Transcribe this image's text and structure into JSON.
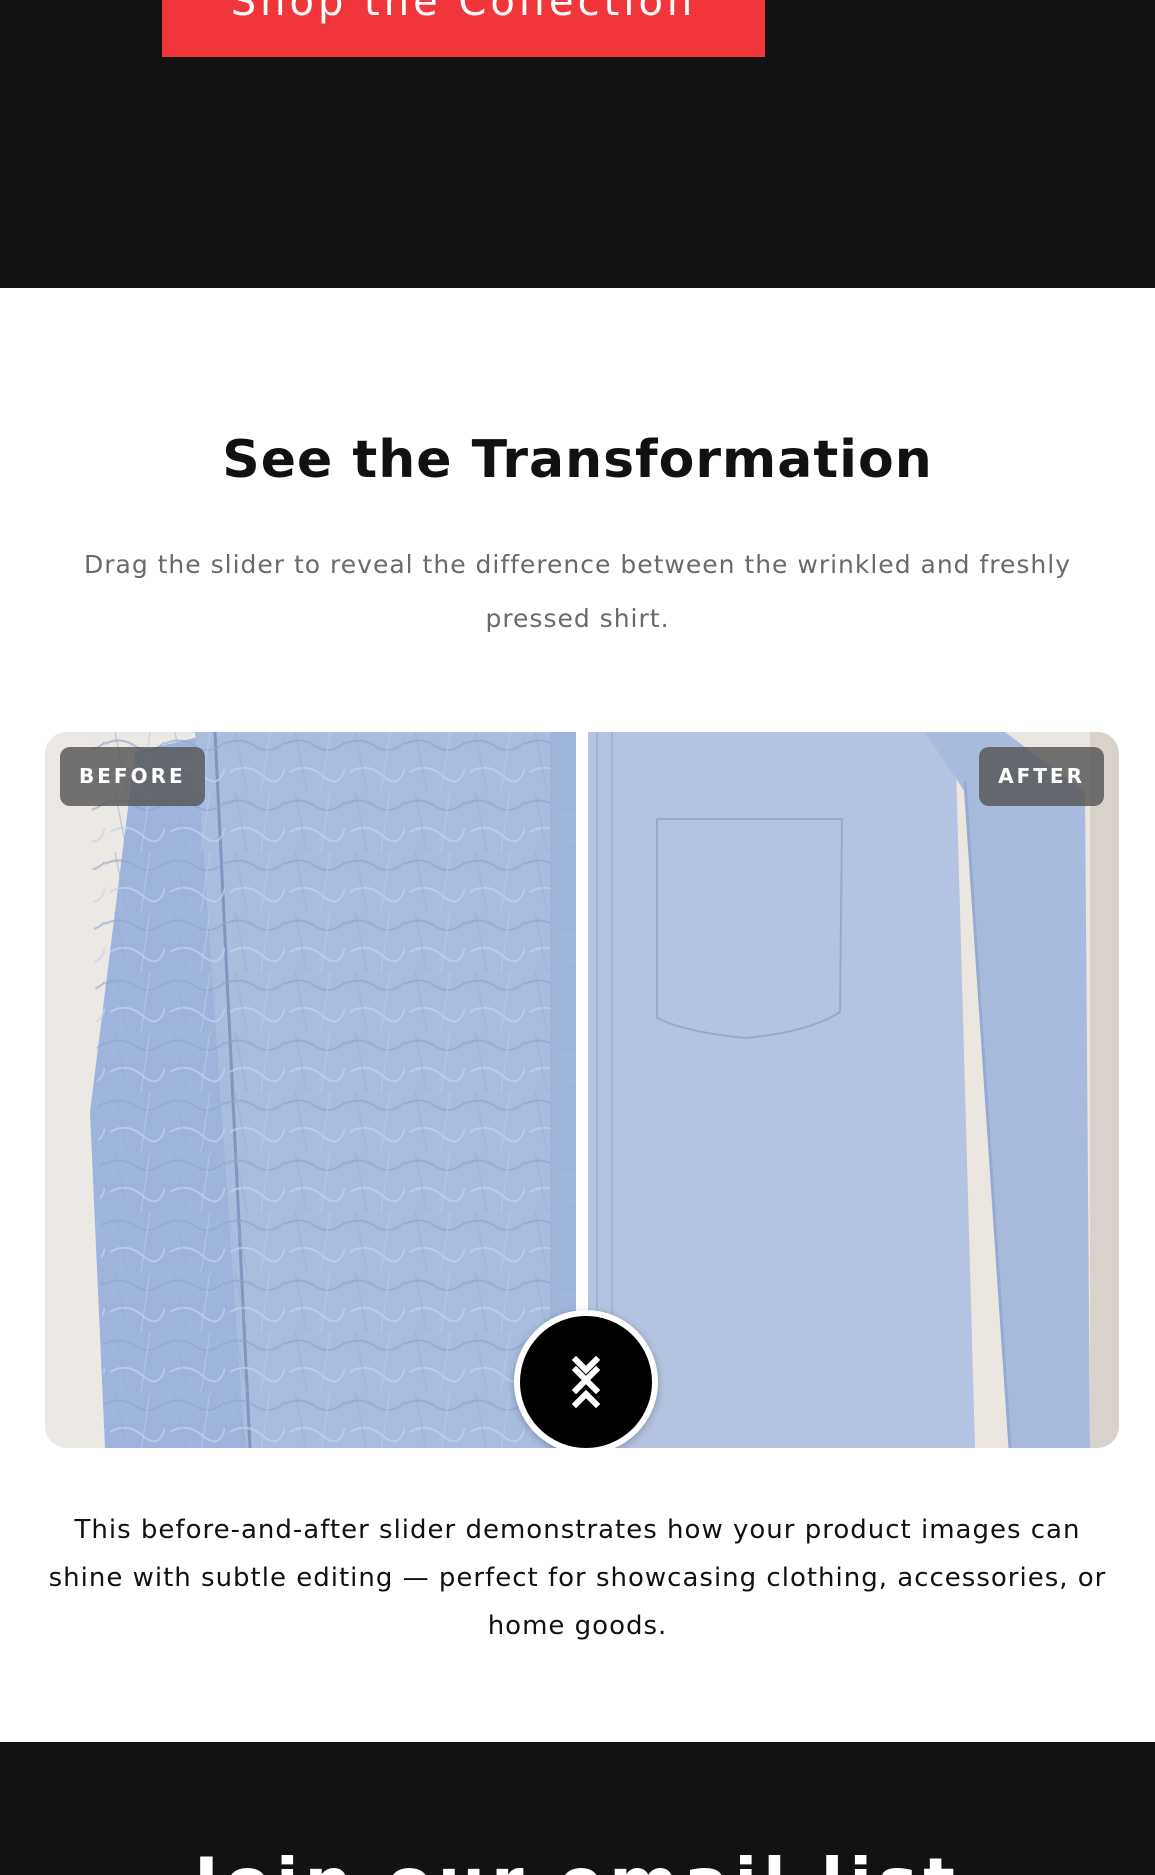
{
  "hero": {
    "cta_label": "Shop the Collection"
  },
  "transformation": {
    "title": "See the Transformation",
    "subtitle": "Drag the slider to reveal the difference between the wrinkled and freshly pressed shirt.",
    "before_label": "BEFORE",
    "after_label": "AFTER",
    "slider_position": 0.5,
    "note": "This before-and-after slider demonstrates how your product images can shine with subtle editing — perfect for showcasing clothing, accessories, or home goods."
  },
  "newsletter": {
    "title": "Join our email list"
  },
  "colors": {
    "dark_background": "#121212",
    "accent_red": "#f0363a",
    "shirt_blue": "#a9bde0",
    "handle": "#000000"
  },
  "icons": {
    "slider_handle": "drag-arrows-icon"
  }
}
